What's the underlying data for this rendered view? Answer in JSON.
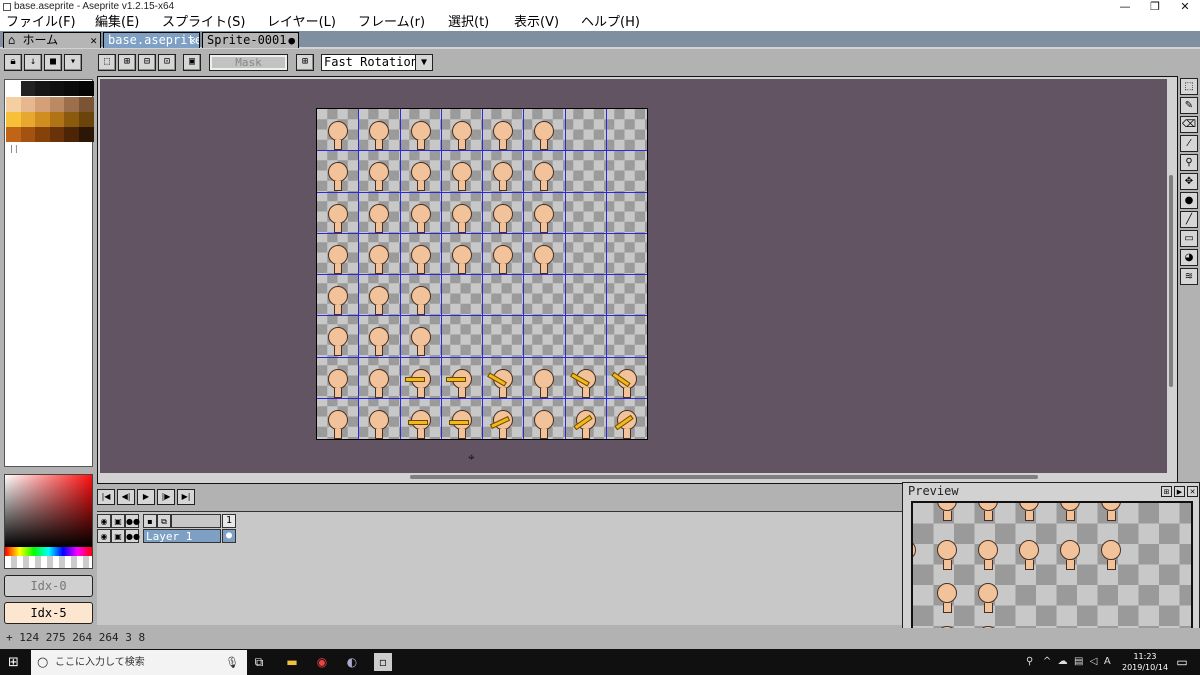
{
  "window": {
    "title": "base.aseprite - Aseprite v1.2.15-x64",
    "minimize": "—",
    "restore": "❐",
    "close": "✕"
  },
  "menu": [
    "ファイル(F)",
    "編集(E)",
    "スプライト(S)",
    "レイヤー(L)",
    "フレーム(r)",
    "選択(t)",
    "表示(V)",
    "ヘルプ(H)"
  ],
  "tabs": [
    {
      "label": "ホーム",
      "icon": "home-icon",
      "close": "✕"
    },
    {
      "label": "base.aseprite",
      "close": "✕",
      "active": true
    },
    {
      "label": "Sprite-0001",
      "close": "●"
    }
  ],
  "toolbar": {
    "mask_label": "Mask",
    "rotation_algorithm": "Fast Rotation"
  },
  "palette": {
    "colors": [
      "#f4d0a0",
      "#e6b890",
      "#d4a078",
      "#bb8a62",
      "#9c6f4c",
      "#7b5436",
      "#f8c038",
      "#e8a830",
      "#d08e20",
      "#b07414",
      "#8c5a0c",
      "#6a440a",
      "#c06418",
      "#a4520f",
      "#86400a",
      "#6a3208",
      "#4e2406",
      "#2c1604"
    ],
    "resize_marker": "||"
  },
  "color_buttons": {
    "fg_label": "Idx-0",
    "bg_label": "Idx-5"
  },
  "status": {
    "text": "+ 124 275  264 264  3 8"
  },
  "timeline": {
    "layer_name": "Layer 1",
    "frame_number": "1"
  },
  "preview": {
    "title": "Preview"
  },
  "taskbar": {
    "search_placeholder": "ここに入力して検索",
    "time": "11:23",
    "date": "2019/10/14",
    "ime": "A"
  }
}
